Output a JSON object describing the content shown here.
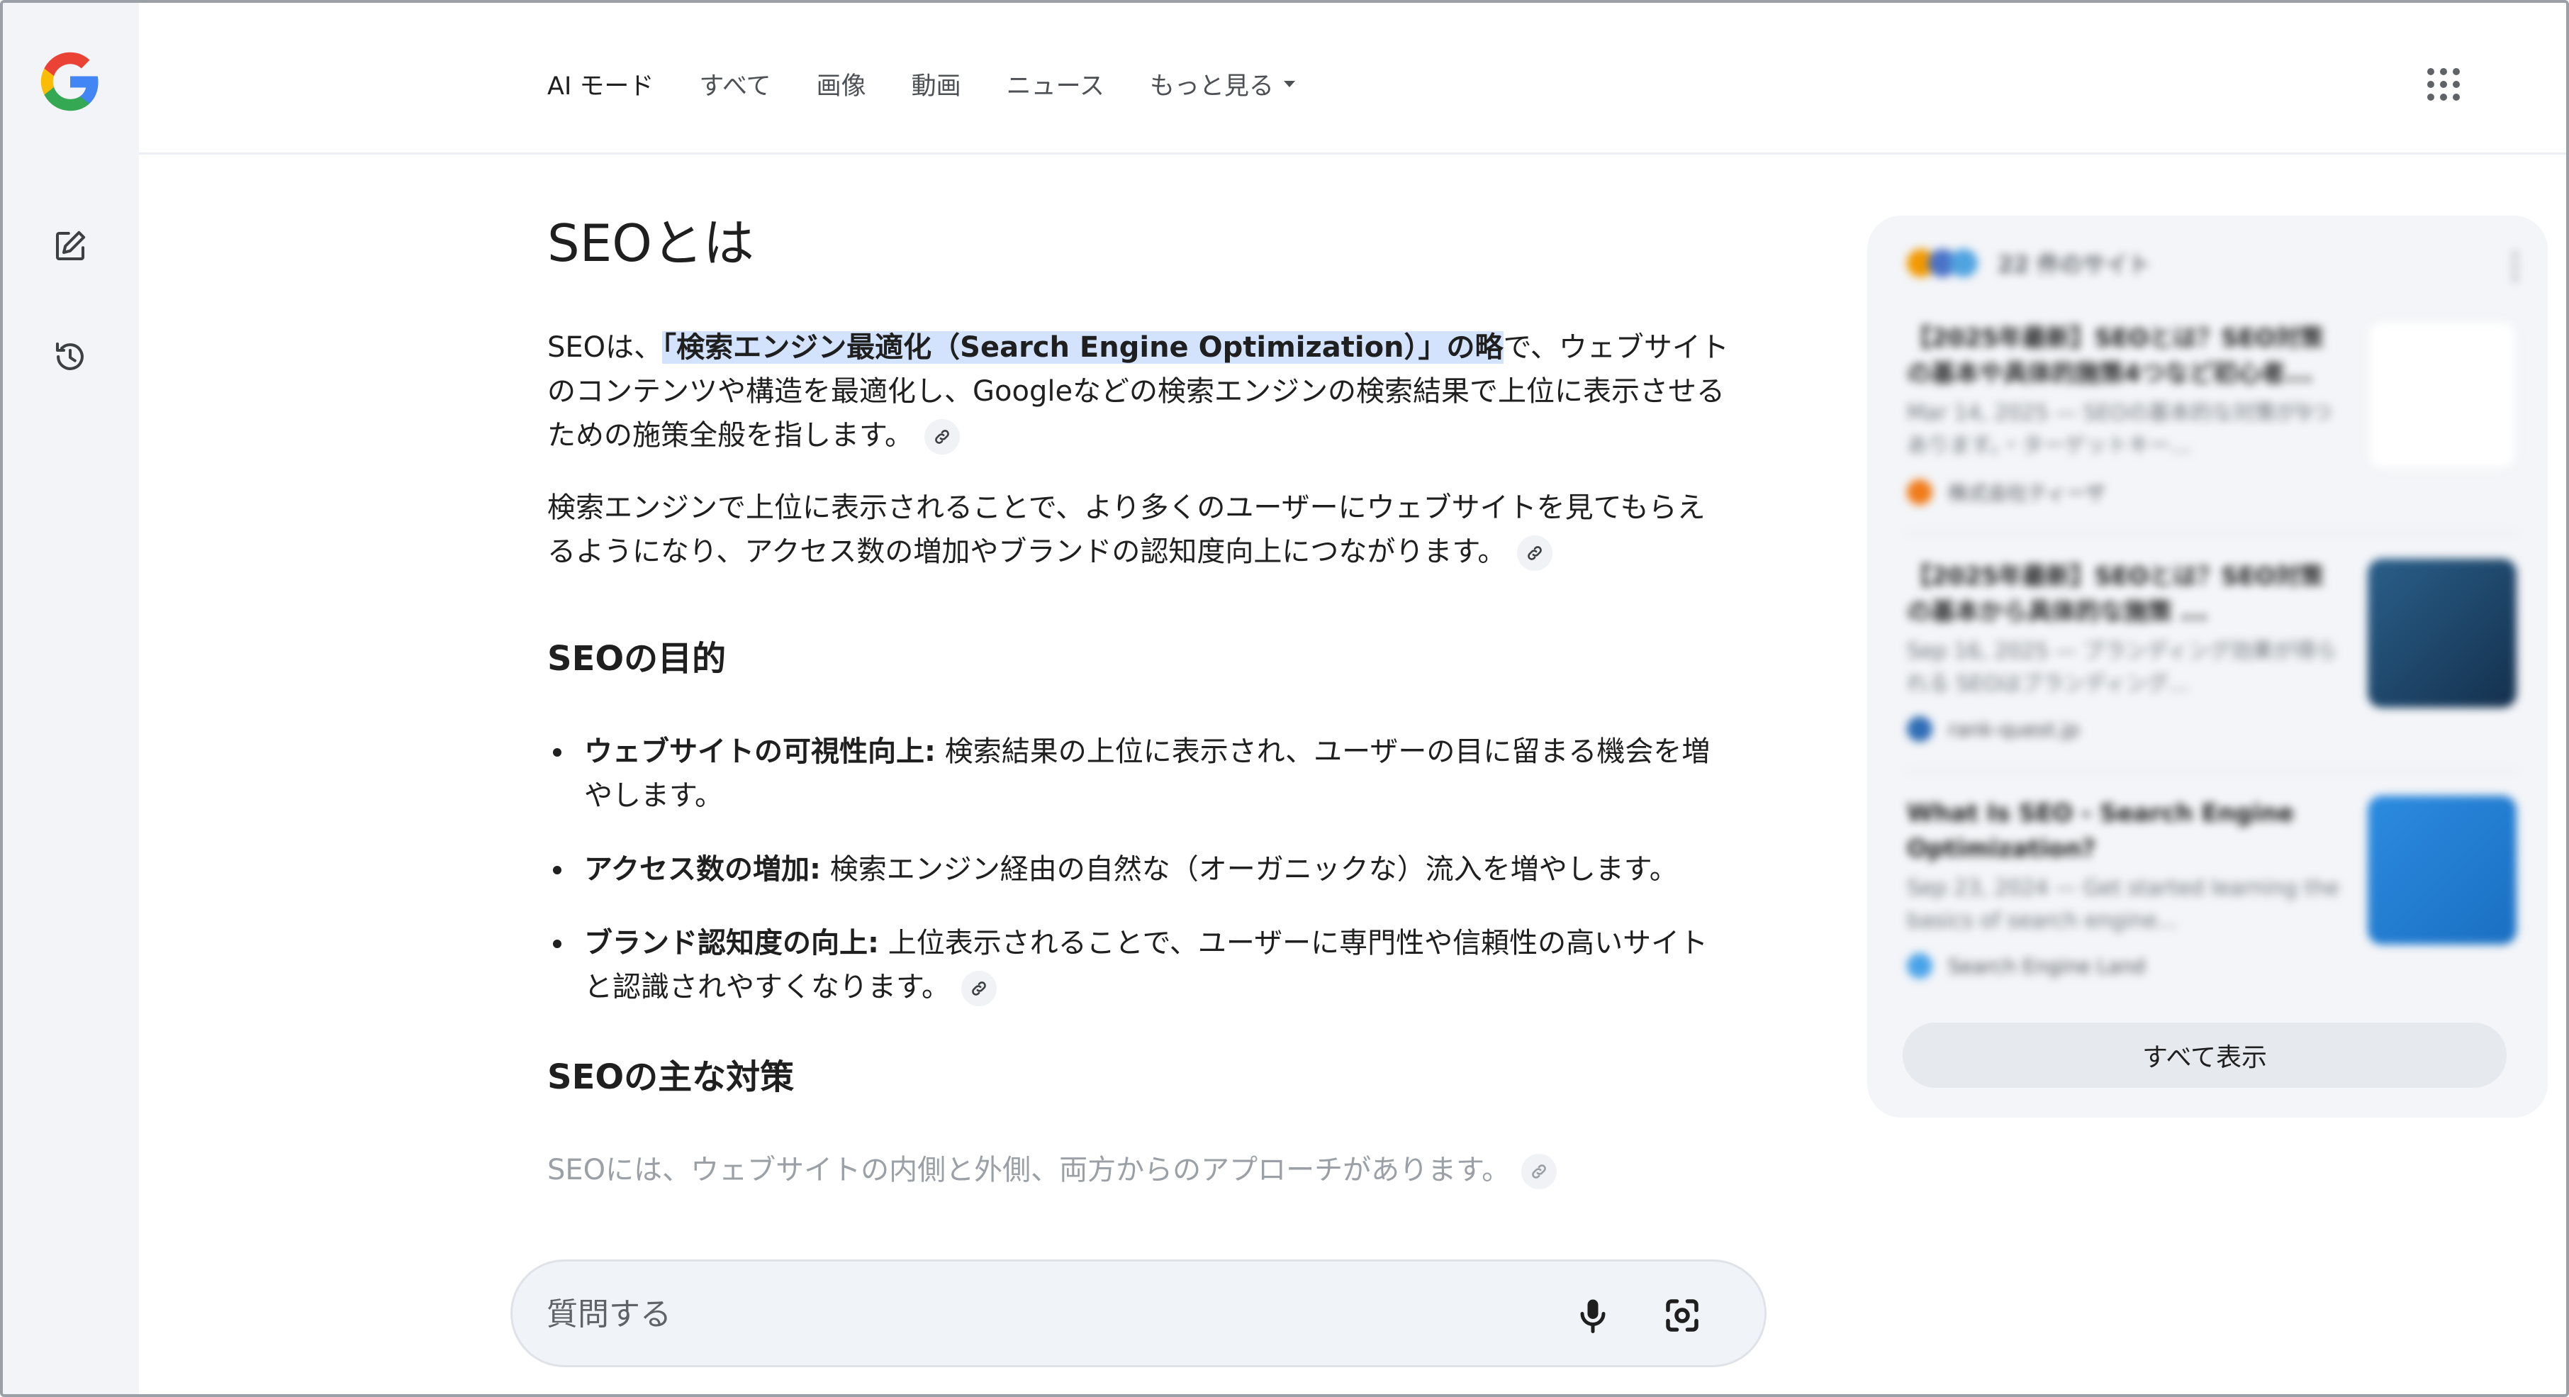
{
  "nav": {
    "tabs": [
      {
        "label": "AI モード"
      },
      {
        "label": "すべて"
      },
      {
        "label": "画像"
      },
      {
        "label": "動画"
      },
      {
        "label": "ニュース"
      },
      {
        "label": "もっと見る"
      }
    ]
  },
  "answer": {
    "title": "SEOとは",
    "p1_pre": "SEOは、",
    "p1_highlight": "「検索エンジン最適化（Search Engine Optimization）」の略",
    "p1_post": "で、ウェブサイトのコンテンツや構造を最適化し、Googleなどの検索エンジンの検索結果で上位に表示させるための施策全般を指します。",
    "p2": "検索エンジンで上位に表示されることで、より多くのユーザーにウェブサイトを見てもらえるようになり、アクセス数の増加やブランドの認知度向上につながります。",
    "section1_title": "SEOの目的",
    "bullets": [
      {
        "term": "ウェブサイトの可視性向上:",
        "text": " 検索結果の上位に表示され、ユーザーの目に留まる機会を増やします。"
      },
      {
        "term": "アクセス数の増加:",
        "text": " 検索エンジン経由の自然な（オーガニックな）流入を増やします。"
      },
      {
        "term": "ブランド認知度の向上:",
        "text": " 上位表示されることで、ユーザーに専門性や信頼性の高いサイトと認識されやすくなります。"
      }
    ],
    "section2_title": "SEOの主な対策",
    "p3": "SEOには、ウェブサイトの内側と外側、両方からのアプローチがあります。"
  },
  "ask": {
    "placeholder": "質問する"
  },
  "sources": {
    "count_label": "22 件のサイト",
    "cards": [
      {
        "title": "【2025年最新】SEOとは？SEO対策の基本や具体的施策4つなど初心者...",
        "snippet": "Mar 14, 2025 — SEOの基本的な対策が9つあります。・ターゲットキー...",
        "site": "株式会社ティーザ"
      },
      {
        "title": "【2025年最新】SEOとは？SEO対策の基本から具体的な施策 ...",
        "snippet": "Sep 16, 2025 — ブランディング効果が得られる SEOはブランディング...",
        "site": "rank-quest.jp"
      },
      {
        "title": "What Is SEO - Search Engine Optimization?",
        "snippet": "Sep 23, 2024 — Get started learning the basics of search engine...",
        "site": "Search Engine Land"
      }
    ],
    "show_all": "すべて表示"
  },
  "colors": {
    "highlight": "#d3e3fd",
    "rail_bg": "#f2f4f7"
  }
}
